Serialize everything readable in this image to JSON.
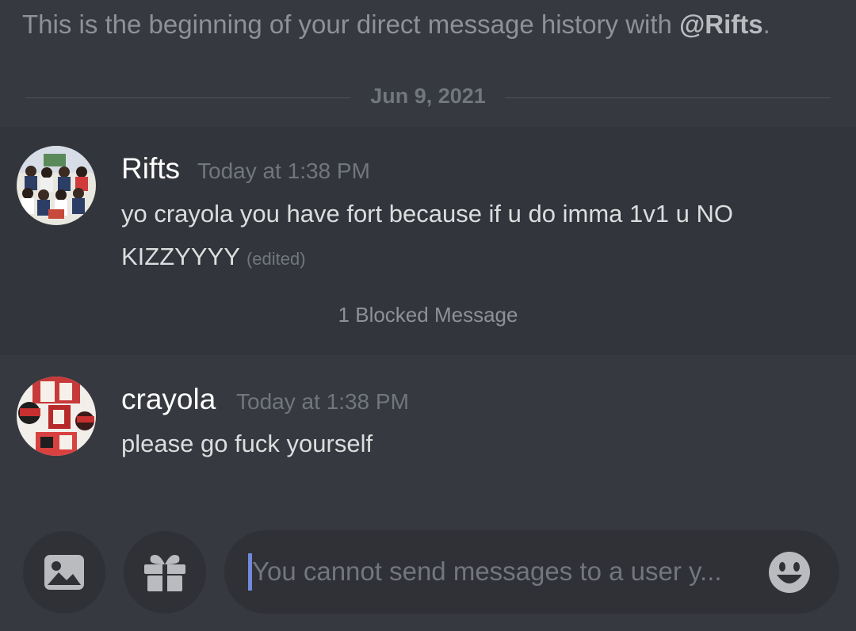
{
  "intro": {
    "text": "This is the beginning of your direct message history with ",
    "mention": "@Rifts",
    "period": "."
  },
  "date_divider": "Jun 9, 2021",
  "messages": [
    {
      "username": "Rifts",
      "timestamp": "Today at 1:38 PM",
      "content_line1": "yo crayola you have fort because if u do imma 1v1 u NO",
      "content_line2": "KIZZYYYY",
      "edited": "(edited)"
    },
    {
      "username": "crayola",
      "timestamp": "Today at 1:38 PM",
      "content_line1": "please go fuck yourself"
    }
  ],
  "blocked_notice": "1 Blocked Message",
  "composer": {
    "placeholder": "You cannot send messages to a user y...",
    "image_icon": "image-icon",
    "gift_icon": "gift-icon",
    "emoji_icon": "emoji-icon"
  },
  "colors": {
    "background": "#36393f",
    "message_highlight": "#32353b",
    "input_background": "#2f3136",
    "caret": "#7289da",
    "username": "#ffffff",
    "muted": "#72767d"
  }
}
